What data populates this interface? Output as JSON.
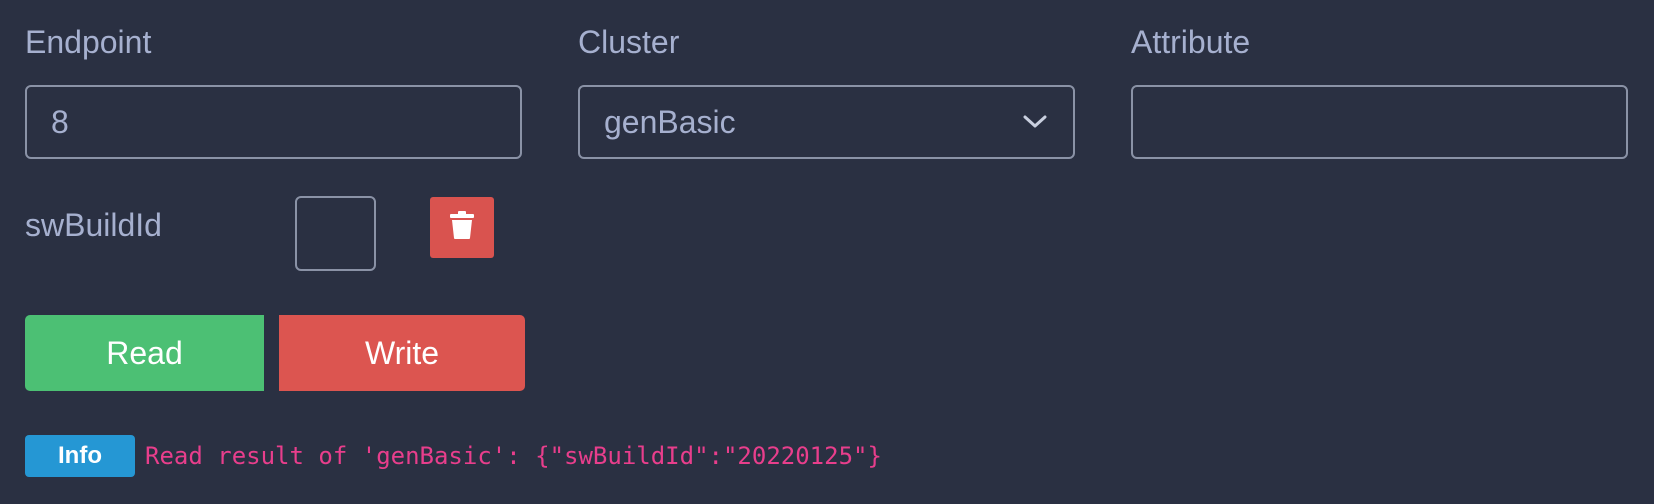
{
  "fields": {
    "endpoint": {
      "label": "Endpoint",
      "value": "8"
    },
    "cluster": {
      "label": "Cluster",
      "value": "genBasic"
    },
    "attribute": {
      "label": "Attribute",
      "value": ""
    }
  },
  "attribute_row": {
    "name": "swBuildId",
    "checked": false,
    "delete_icon": "trash-icon"
  },
  "actions": {
    "read_label": "Read",
    "write_label": "Write"
  },
  "log": {
    "badge": "Info",
    "message": "Read result of 'genBasic': {\"swBuildId\":\"20220125\"}"
  },
  "colors": {
    "background": "#2a3042",
    "read": "#4cc074",
    "write": "#dc5550",
    "delete": "#d9534f",
    "info_badge": "#2597d4",
    "message_text": "#e83e8c"
  }
}
